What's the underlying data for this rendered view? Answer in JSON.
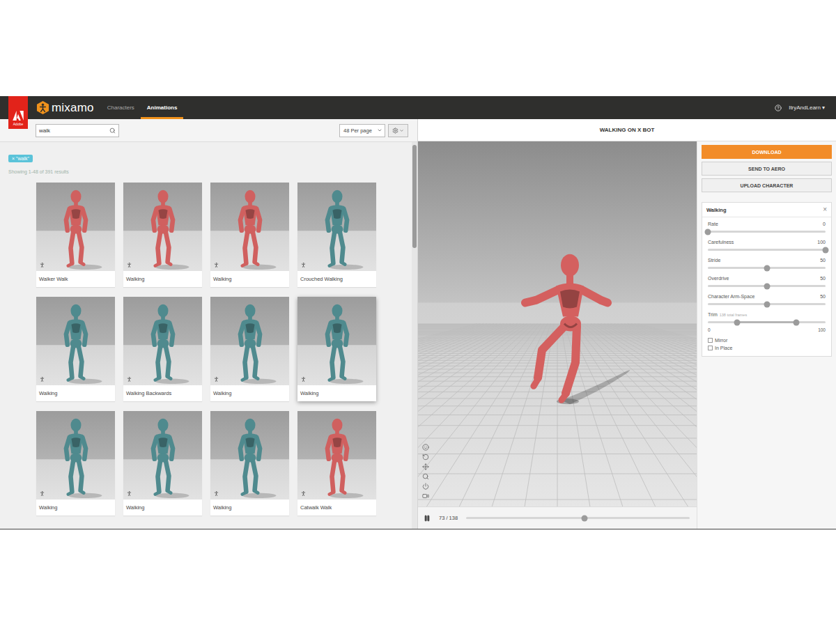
{
  "brand": {
    "adobe": "Adobe",
    "name": "mixamo"
  },
  "nav": [
    {
      "label": "Characters",
      "selected": false
    },
    {
      "label": "Animations",
      "selected": true
    }
  ],
  "user": {
    "name": "ItryAndLearn",
    "caret": "▾"
  },
  "search": {
    "value": "walk"
  },
  "per_page": "48 Per page",
  "filter_tag": "× \"walk\"",
  "results": "Showing 1-48 of 391 results",
  "cards": [
    {
      "label": "Walker Walk",
      "color": "#d0605f",
      "highlighted": false
    },
    {
      "label": "Walking",
      "color": "#d0605f",
      "highlighted": false
    },
    {
      "label": "Walking",
      "color": "#d0605f",
      "highlighted": false
    },
    {
      "label": "Crouched Walking",
      "color": "#4f8a8e",
      "highlighted": false
    },
    {
      "label": "Walking",
      "color": "#4f8a8e",
      "highlighted": false
    },
    {
      "label": "Walking Backwards",
      "color": "#4f8a8e",
      "highlighted": false
    },
    {
      "label": "Walking",
      "color": "#4f8a8e",
      "highlighted": false
    },
    {
      "label": "Walking",
      "color": "#4f8a8e",
      "highlighted": true
    },
    {
      "label": "Walking",
      "color": "#4f8a8e",
      "highlighted": false
    },
    {
      "label": "Walking",
      "color": "#4f8a8e",
      "highlighted": false
    },
    {
      "label": "Walking",
      "color": "#4f8a8e",
      "highlighted": false
    },
    {
      "label": "Catwalk Walk",
      "color": "#d0605f",
      "highlighted": false
    }
  ],
  "preview": {
    "title": "WALKING ON X BOT",
    "frame": "73 / 138",
    "level": 0.53,
    "playing": true
  },
  "actions": [
    {
      "label": "DOWNLOAD",
      "primary": true
    },
    {
      "label": "SEND TO AERO",
      "primary": false
    },
    {
      "label": "UPLOAD CHARACTER",
      "primary": false
    }
  ],
  "settings": {
    "title": "Walking",
    "close": "×",
    "sliders": [
      {
        "label": "Rate",
        "value": "0",
        "level": 0
      },
      {
        "label": "Carefulness",
        "value": "100",
        "level": 1
      },
      {
        "label": "Stride",
        "value": "50",
        "level": 0.5
      },
      {
        "label": "Overdrive",
        "value": "50",
        "level": 0.5
      },
      {
        "label": "Character Arm-Space",
        "value": "50",
        "level": 0.5
      }
    ],
    "trim": {
      "label": "Trim",
      "note": "138 total frames",
      "low": 0.25,
      "high": 0.75,
      "min": "0",
      "max": "100"
    },
    "options": [
      {
        "label": "Mirror",
        "checked": false
      },
      {
        "label": "In Place",
        "checked": false
      }
    ]
  }
}
